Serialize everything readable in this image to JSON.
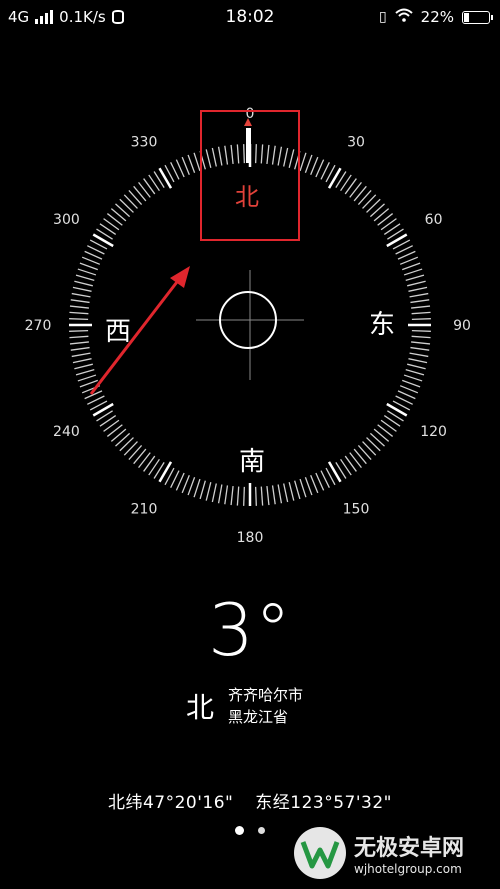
{
  "status_bar": {
    "network": "4G",
    "speed": "0.1K/s",
    "time": "18:02",
    "battery": "22%",
    "battery_level": 0.22
  },
  "compass": {
    "degree_labels": [
      "0",
      "30",
      "60",
      "90",
      "120",
      "150",
      "180",
      "210",
      "240",
      "270",
      "300",
      "330"
    ],
    "directions": {
      "north": "北",
      "east": "东",
      "south": "南",
      "west": "西"
    },
    "accent_color": "#e2423a"
  },
  "heading": {
    "value": "3°",
    "direction": "北"
  },
  "location": {
    "city": "齐齐哈尔市",
    "province": "黑龙江省"
  },
  "coordinates": {
    "latitude": "北纬47°20'16\"",
    "longitude": "东经123°57'32\""
  },
  "pager": {
    "pages": 2,
    "current": 1
  },
  "watermark": {
    "title": "无极安卓网",
    "url": "wjhotelgroup.com"
  }
}
